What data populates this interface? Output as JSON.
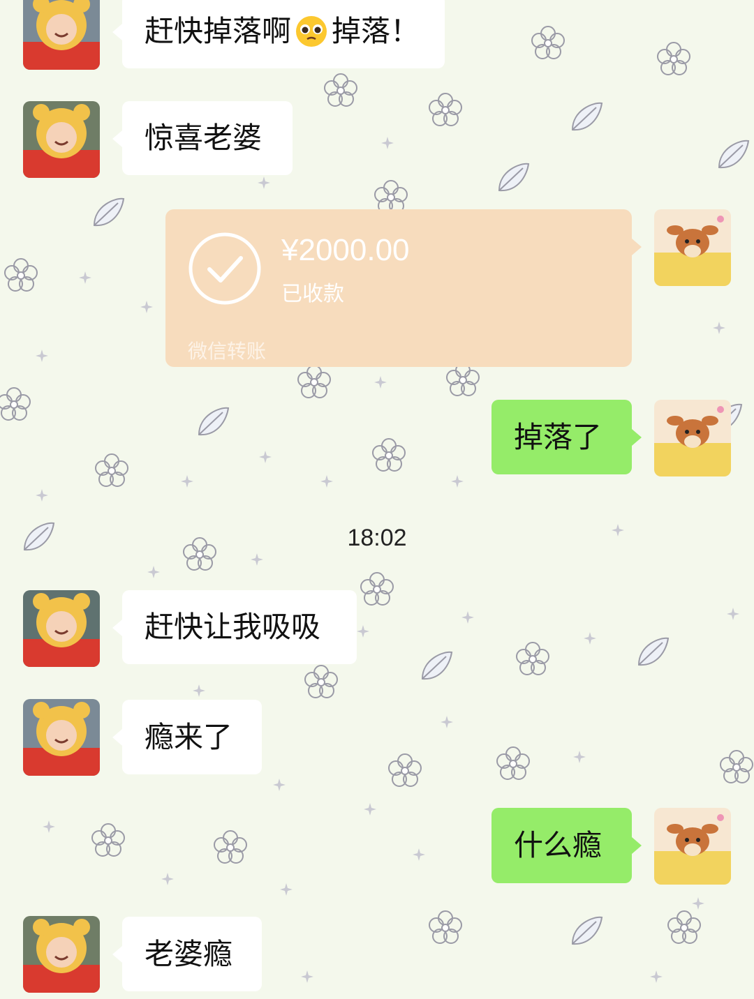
{
  "messages": [
    {
      "side": "in",
      "text_before": "赶快掉落啊",
      "emoji": "pleading-face-emoji",
      "text_after": "掉落！"
    },
    {
      "side": "in",
      "text": "惊喜老婆"
    },
    {
      "side": "out",
      "type": "transfer",
      "amount": "¥2000.00",
      "status": "已收款",
      "brand": "微信转账"
    },
    {
      "side": "out",
      "text": "掉落了"
    },
    {
      "type": "time",
      "text": "18:02"
    },
    {
      "side": "in",
      "text": "赶快让我吸吸"
    },
    {
      "side": "in",
      "text": "瘾来了"
    },
    {
      "side": "out",
      "text": "什么瘾"
    },
    {
      "side": "in",
      "text": "老婆瘾"
    }
  ],
  "colors": {
    "background": "#f4f8ec",
    "incoming_bubble": "#ffffff",
    "outgoing_bubble": "#95ec69",
    "transfer_card": "#f7dcbd"
  },
  "avatars": {
    "contact": "toddler-in-bear-costume-avatar",
    "self": "fawn-cartoon-avatar"
  }
}
